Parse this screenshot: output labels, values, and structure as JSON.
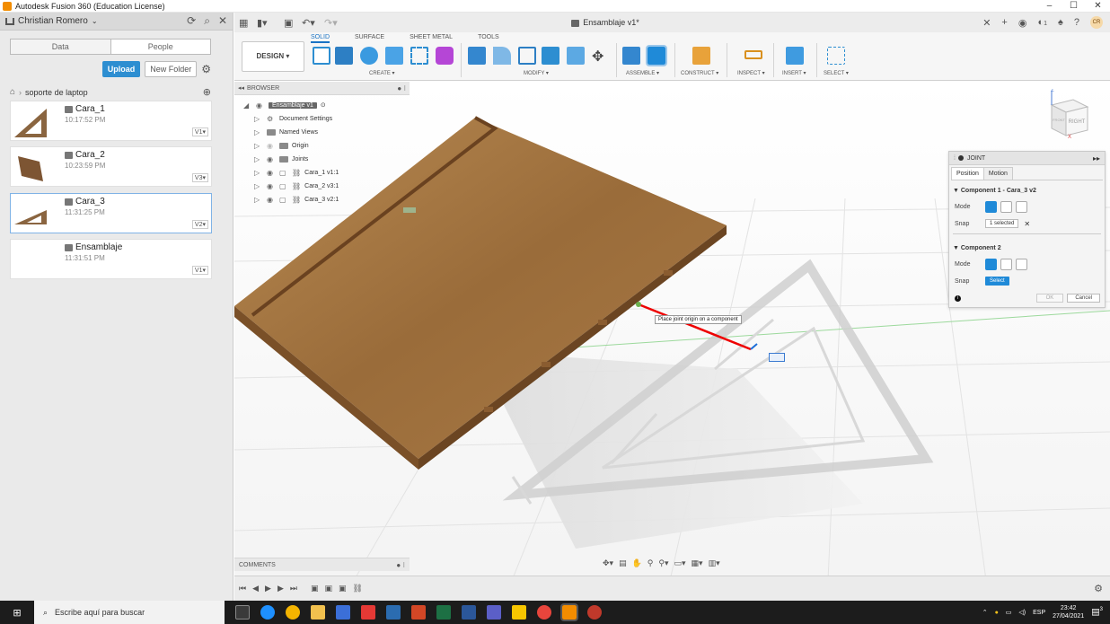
{
  "window": {
    "title": "Autodesk Fusion 360 (Education License)",
    "minimize": "–",
    "maximize": "☐",
    "close": "✕"
  },
  "data_panel": {
    "user": "Christian Romero",
    "tabs": [
      "Data",
      "People"
    ],
    "upload_label": "Upload",
    "new_folder_label": "New Folder",
    "breadcrumb": "soporte de laptop",
    "files": [
      {
        "name": "Cara_1",
        "time": "10:17:52 PM",
        "version": "V1▾"
      },
      {
        "name": "Cara_2",
        "time": "10:23:59 PM",
        "version": "V3▾"
      },
      {
        "name": "Cara_3",
        "time": "11:31:25 PM",
        "version": "V2▾"
      },
      {
        "name": "Ensamblaje",
        "time": "11:31:51 PM",
        "version": "V1▾"
      }
    ]
  },
  "document": {
    "tab_title": "Ensamblaje v1*",
    "avatar": "CR",
    "notif_count": "1"
  },
  "ribbon": {
    "workspace": "DESIGN ▾",
    "tabs": [
      "SOLID",
      "SURFACE",
      "SHEET METAL",
      "TOOLS"
    ],
    "groups": [
      "CREATE ▾",
      "MODIFY ▾",
      "ASSEMBLE ▾",
      "CONSTRUCT ▾",
      "INSPECT ▾",
      "INSERT ▾",
      "SELECT ▾"
    ]
  },
  "browser": {
    "title": "BROWSER",
    "root": "Ensamblaje v1",
    "items": [
      "Document Settings",
      "Named Views",
      "Origin",
      "Joints",
      "Cara_1 v1:1",
      "Cara_2 v3:1",
      "Cara_3 v2:1"
    ]
  },
  "viewcube": {
    "face": "RIGHT",
    "front": "FRONT",
    "axis_z": "Z",
    "axis_x": "X"
  },
  "joint_panel": {
    "title": "JOINT",
    "tabs": [
      "Position",
      "Motion"
    ],
    "component1": "▼ Component 1 - Cara_3 v2",
    "component2": "▼ Component 2",
    "mode_label": "Mode",
    "snap_label": "Snap",
    "snap1_value": "1 selected",
    "snap2_value": "Select",
    "ok": "OK",
    "cancel": "Cancel"
  },
  "tooltip": "Place joint origin on a component",
  "comments": "COMMENTS",
  "taskbar": {
    "search": "Escribe aquí para buscar",
    "lang": "ESP",
    "time": "23:42",
    "date": "27/04/2021",
    "notif": "3"
  },
  "colors": {
    "accent": "#1f8ad8",
    "wood": "#a97a45",
    "taskbar": "#1c1c1c"
  }
}
